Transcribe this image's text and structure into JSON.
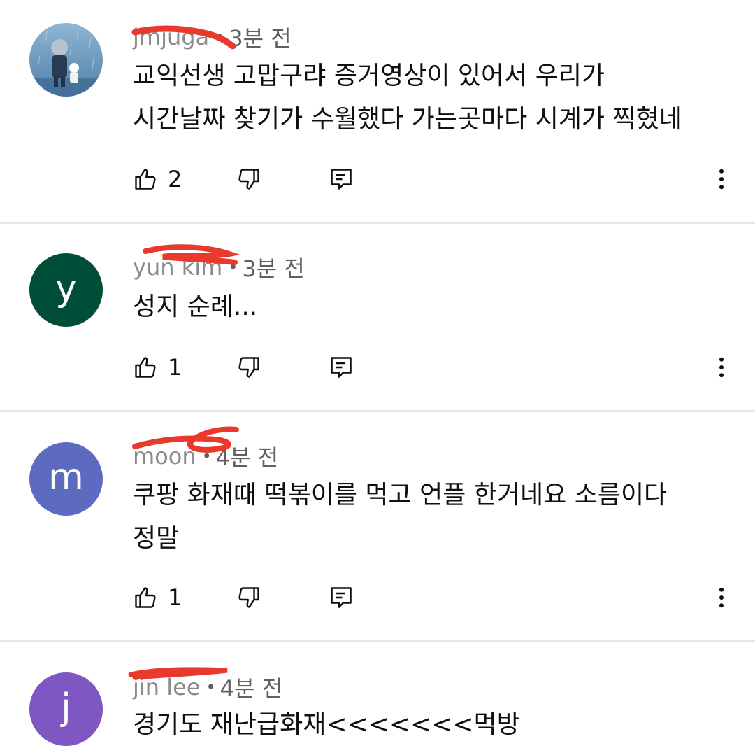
{
  "comments": [
    {
      "username": "jmjuga",
      "time": "3분 전",
      "text_lines": [
        "교익선생 고맙구랴 증거영상이 있어서 우리가",
        "시간날짜 찾기가 수월했다 가는곳마다 시계가 찍혔네"
      ],
      "likes": "2",
      "avatar_type": "image",
      "avatar_icon": "painting-figures-icon"
    },
    {
      "username": "yun kim",
      "time": "3분 전",
      "text_lines": [
        "성지 순례..."
      ],
      "likes": "1",
      "avatar_letter": "y",
      "avatar_color": "#004d3a"
    },
    {
      "username": "moon",
      "time": "4분 전",
      "text_lines": [
        "쿠팡 화재때 떡볶이를 먹고 언플 한거네요 소름이다",
        "정말"
      ],
      "likes": "1",
      "avatar_letter": "m",
      "avatar_color": "#5c6bc0"
    },
    {
      "username": "jin lee",
      "time": "4분 전",
      "text_lines": [
        "경기도 재난급화재<<<<<<<먹방"
      ],
      "avatar_letter": "j",
      "avatar_color": "#7e57c2"
    }
  ],
  "icons": {
    "like": "thumbs-up-icon",
    "dislike": "thumbs-down-icon",
    "reply": "reply-icon",
    "more": "more-vertical-icon"
  },
  "colors": {
    "redaction": "#e8392c",
    "divider": "#e5e5e5",
    "meta_text": "#606060"
  }
}
